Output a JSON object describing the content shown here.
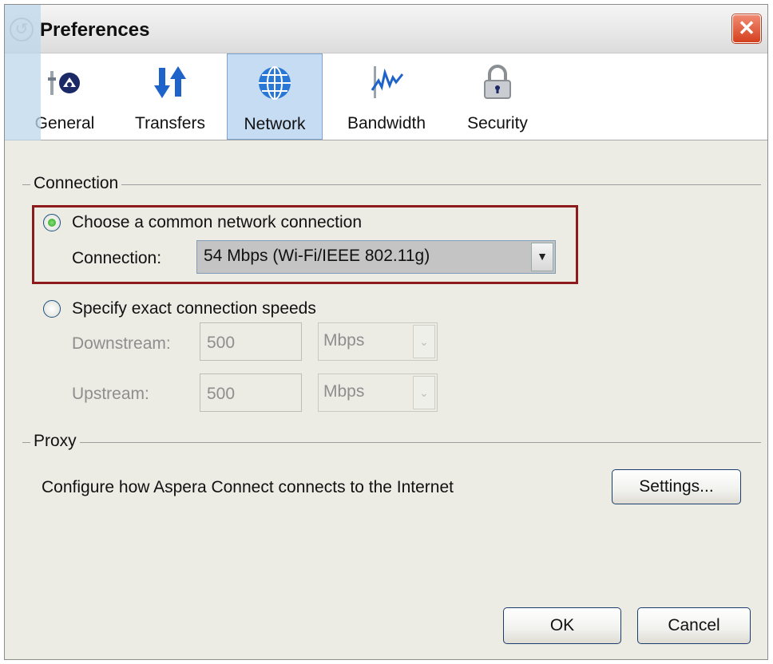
{
  "window": {
    "title": "Preferences"
  },
  "toolbar": {
    "tabs": [
      {
        "label": "General",
        "icon": "general-settings-icon"
      },
      {
        "label": "Transfers",
        "icon": "transfer-arrows-icon"
      },
      {
        "label": "Network",
        "icon": "globe-icon",
        "active": true
      },
      {
        "label": "Bandwidth",
        "icon": "bandwidth-graph-icon"
      },
      {
        "label": "Security",
        "icon": "padlock-icon"
      }
    ]
  },
  "connection": {
    "group_title": "Connection",
    "option_common": "Choose a common network connection",
    "connection_label": "Connection:",
    "connection_value": "54 Mbps (Wi-Fi/IEEE 802.11g)",
    "option_exact": "Specify exact connection speeds",
    "downstream_label": "Downstream:",
    "downstream_value": "500",
    "downstream_unit": "Mbps",
    "upstream_label": "Upstream:",
    "upstream_value": "500",
    "upstream_unit": "Mbps"
  },
  "proxy": {
    "group_title": "Proxy",
    "description": "Configure how Aspera Connect connects to the Internet",
    "settings_label": "Settings..."
  },
  "footer": {
    "ok_label": "OK",
    "cancel_label": "Cancel"
  },
  "colors": {
    "accent": "#c6dcf2",
    "highlight_border": "#8c1c1c",
    "close": "#d4401e"
  }
}
